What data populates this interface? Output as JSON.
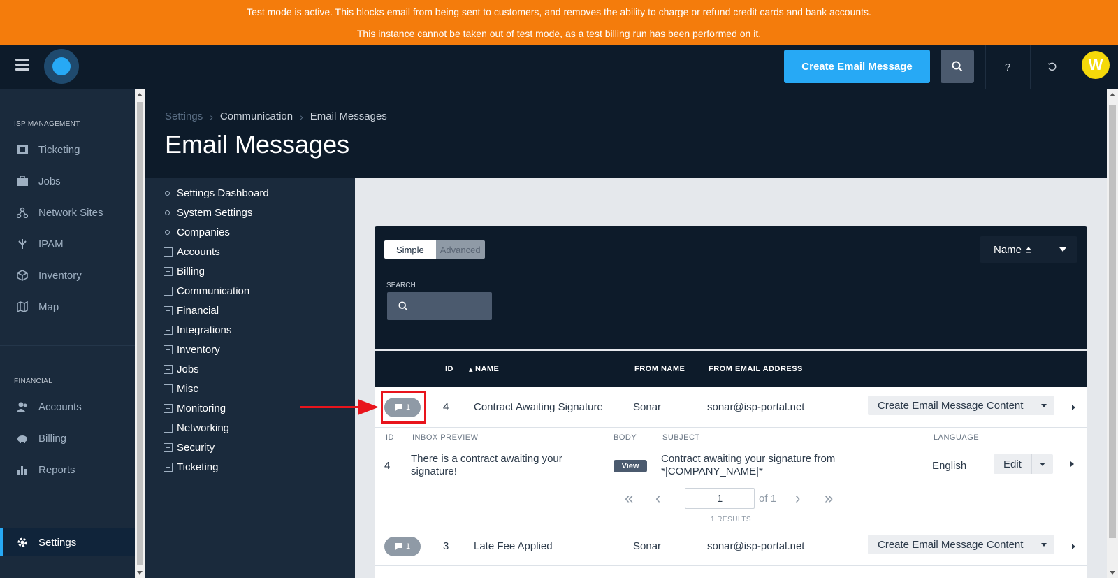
{
  "banner": {
    "line1": "Test mode is active. This blocks email from being sent to customers, and removes the ability to charge or refund credit cards and bank accounts.",
    "line2": "This instance cannot be taken out of test mode, as a test billing run has been performed on it."
  },
  "topbar": {
    "create_label": "Create Email Message",
    "help_label": "?",
    "avatar_initial": "W",
    "icons": [
      "hamburger-icon",
      "logo",
      "search-icon",
      "help-icon",
      "history-icon"
    ]
  },
  "sidebar": {
    "section1": "ISP MANAGEMENT",
    "section2": "FINANCIAL",
    "items1": [
      {
        "label": "Ticketing",
        "icon": "ticket-icon"
      },
      {
        "label": "Jobs",
        "icon": "briefcase-icon"
      },
      {
        "label": "Network Sites",
        "icon": "network-icon"
      },
      {
        "label": "IPAM",
        "icon": "ipam-icon"
      },
      {
        "label": "Inventory",
        "icon": "box-icon"
      },
      {
        "label": "Map",
        "icon": "map-icon"
      }
    ],
    "items2": [
      {
        "label": "Accounts",
        "icon": "accounts-icon"
      },
      {
        "label": "Billing",
        "icon": "piggy-bank-icon"
      },
      {
        "label": "Reports",
        "icon": "bar-chart-icon"
      }
    ],
    "settings": {
      "label": "Settings",
      "icon": "gear-icon"
    }
  },
  "breadcrumb": [
    "Settings",
    "Communication",
    "Email Messages"
  ],
  "page_title": "Email Messages",
  "subnav": {
    "plain": [
      "Settings Dashboard",
      "System Settings",
      "Companies"
    ],
    "expandable": [
      "Accounts",
      "Billing",
      "Communication",
      "Financial",
      "Integrations",
      "Inventory",
      "Jobs",
      "Misc",
      "Monitoring",
      "Networking",
      "Security",
      "Ticketing"
    ]
  },
  "filter": {
    "simple": "Simple",
    "advanced": "Advanced",
    "search_label": "SEARCH",
    "sort_label": "Name"
  },
  "table": {
    "headers": {
      "id": "ID",
      "name": "NAME",
      "from_name": "FROM NAME",
      "from_email": "FROM EMAIL ADDRESS"
    },
    "rows": [
      {
        "count": "1",
        "id": "4",
        "name": "Contract Awaiting Signature",
        "from_name": "Sonar",
        "from_email": "sonar@isp-portal.net",
        "action": "Create Email Message Content"
      },
      {
        "count": "1",
        "id": "3",
        "name": "Late Fee Applied",
        "from_name": "Sonar",
        "from_email": "sonar@isp-portal.net",
        "action": "Create Email Message Content"
      }
    ],
    "sub": {
      "headers": {
        "id": "ID",
        "preview": "INBOX PREVIEW",
        "body": "BODY",
        "subject": "SUBJECT",
        "language": "LANGUAGE"
      },
      "row": {
        "id": "4",
        "preview_line1": "There is a contract awaiting your",
        "preview_line2": "signature!",
        "body_btn": "View",
        "subject_line1": "Contract awaiting your signature from",
        "subject_line2": "*|COMPANY_NAME|*",
        "language": "English",
        "edit": "Edit"
      },
      "pager": {
        "page": "1",
        "of": "of 1",
        "results": "1 RESULTS"
      }
    }
  },
  "colors": {
    "banner": "#f47c0c",
    "accent": "#27a9f5",
    "highlight": "#e8141c",
    "avatar": "#f5d90a"
  }
}
